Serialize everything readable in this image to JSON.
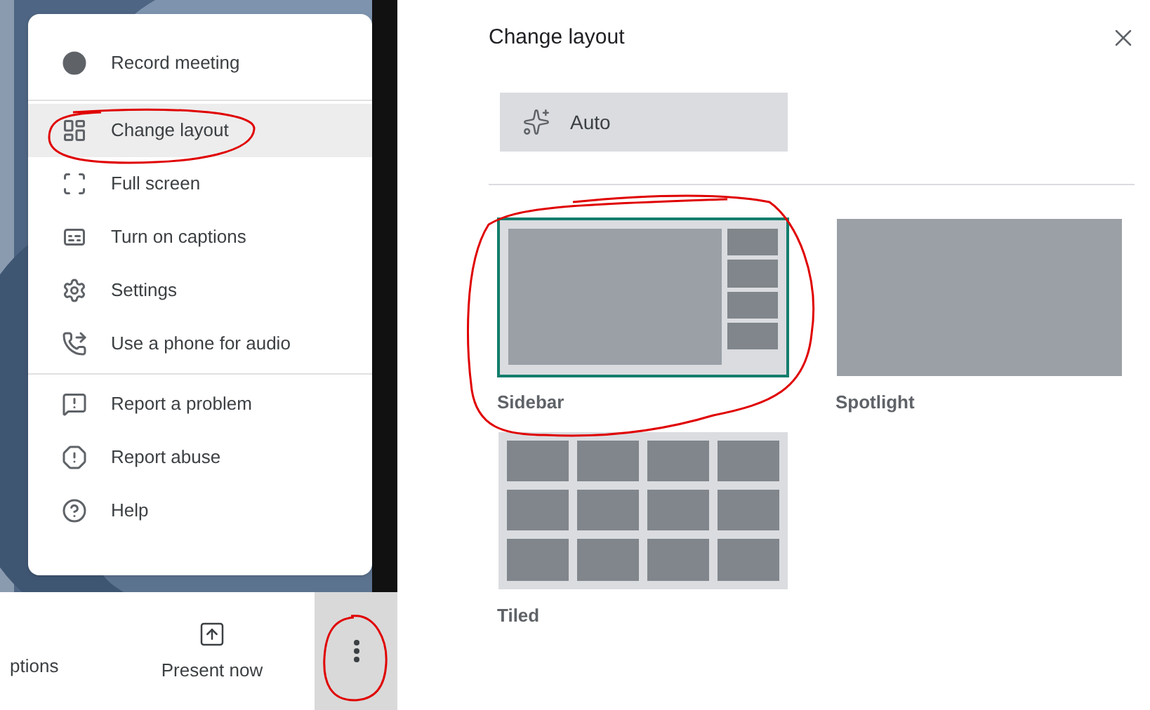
{
  "menu": {
    "sections": [
      {
        "items": [
          {
            "kind": "record",
            "label": "Record meeting",
            "selected": false
          }
        ]
      },
      {
        "items": [
          {
            "kind": "layout",
            "label": "Change layout",
            "selected": true
          },
          {
            "kind": "fullscreen",
            "label": "Full screen",
            "selected": false
          },
          {
            "kind": "captions",
            "label": "Turn on captions",
            "selected": false
          },
          {
            "kind": "settings",
            "label": "Settings",
            "selected": false
          },
          {
            "kind": "phone",
            "label": "Use a phone for audio",
            "selected": false
          }
        ]
      },
      {
        "items": [
          {
            "kind": "report",
            "label": "Report a problem",
            "selected": false
          },
          {
            "kind": "abuse",
            "label": "Report abuse",
            "selected": false
          },
          {
            "kind": "help",
            "label": "Help",
            "selected": false
          }
        ]
      }
    ]
  },
  "toolbar": {
    "captions_label": "ptions",
    "present_label": "Present now",
    "more_selected": true
  },
  "dialog": {
    "title": "Change layout",
    "auto_label": "Auto",
    "layouts": [
      {
        "kind": "sidebar",
        "label": "Sidebar",
        "selected": true
      },
      {
        "kind": "spotlight",
        "label": "Spotlight",
        "selected": false
      },
      {
        "kind": "tiled",
        "label": "Tiled",
        "selected": false
      }
    ]
  }
}
